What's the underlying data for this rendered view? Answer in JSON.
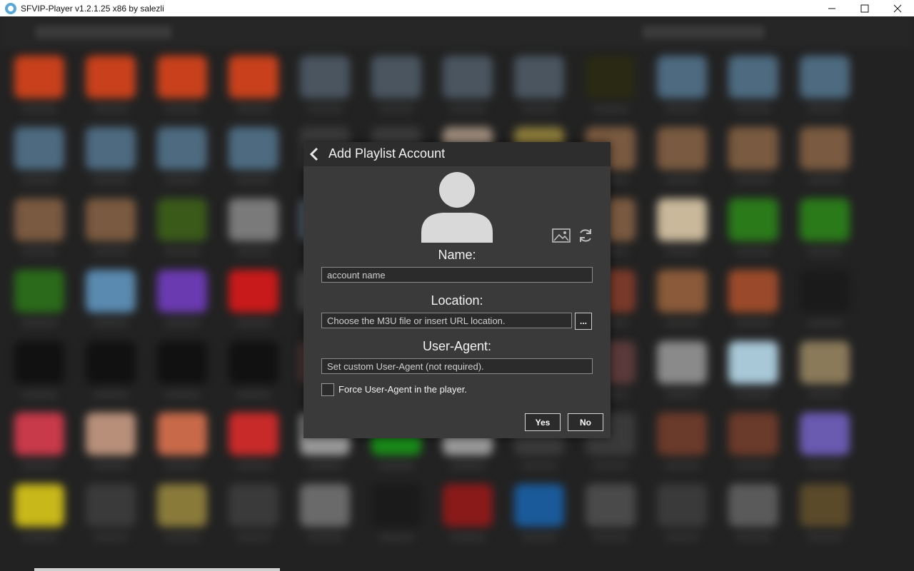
{
  "window": {
    "title": "SFVIP-Player v1.2.1.25 x86 by salezli",
    "minimize_icon": "minimize-icon",
    "maximize_icon": "maximize-icon",
    "close_icon": "close-icon"
  },
  "dialog": {
    "title": "Add Playlist Account",
    "back_icon": "chevron-left-icon",
    "avatar_icon": "user-avatar-icon",
    "image_icon": "image-icon",
    "refresh_icon": "refresh-icon",
    "name_label": "Name:",
    "name_placeholder": "account name",
    "location_label": "Location:",
    "location_placeholder": "Choose the M3U file or insert URL location.",
    "browse_label": "...",
    "useragent_label": "User-Agent:",
    "useragent_placeholder": "Set custom User-Agent (not required).",
    "force_label": "Force User-Agent in the player.",
    "force_checked": false,
    "yes_label": "Yes",
    "no_label": "No"
  },
  "colors": {
    "dialog_bg": "#3a3a3a",
    "header_bg": "#2d2d2d",
    "field_bg": "#2b2b2b",
    "backdrop": "#222222"
  }
}
